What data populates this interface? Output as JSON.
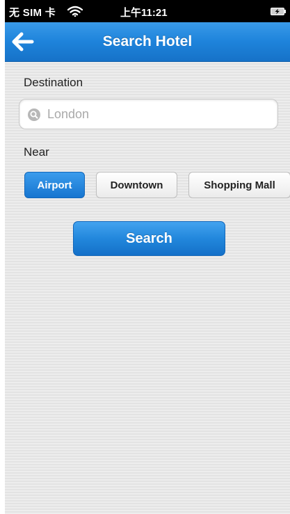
{
  "status_bar": {
    "carrier": "无 SIM 卡",
    "time": "上午11:21",
    "wifi_icon": "wifi-icon",
    "battery_icon": "battery-charging-icon"
  },
  "nav": {
    "back_icon": "arrow-left-icon",
    "title": "Search Hotel",
    "color": "#1e83db"
  },
  "form": {
    "destination_label": "Destination",
    "destination_input": {
      "value": "",
      "placeholder": "London",
      "icon": "search-icon"
    },
    "near_label": "Near",
    "near_options": [
      {
        "label": "Airport",
        "selected": true
      },
      {
        "label": "Downtown",
        "selected": false
      },
      {
        "label": "Shopping Mall",
        "selected": false
      }
    ],
    "search_button_label": "Search"
  },
  "colors": {
    "accent": "#1e83db",
    "background": "#ececec",
    "status_bar": "#000000"
  }
}
